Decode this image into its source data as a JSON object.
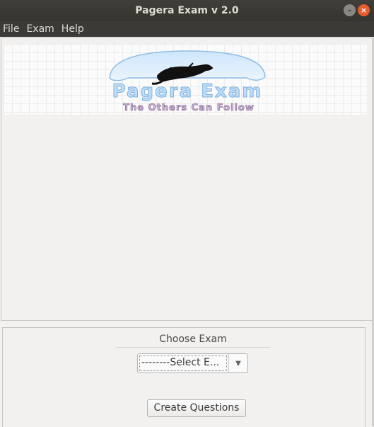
{
  "window": {
    "title": "Pagera Exam v 2.0"
  },
  "menubar": {
    "items": [
      "File",
      "Exam",
      "Help"
    ]
  },
  "banner": {
    "logo_text": "Pagera Exam",
    "tagline": "The Others Can Follow"
  },
  "choose": {
    "title": "Choose Exam",
    "selected": "--------Select E...",
    "create_label": "Create Questions"
  },
  "colors": {
    "titlebar": "#3f3e39",
    "close_button": "#e95a2c",
    "logo_blue": "#8fc3f0",
    "tagline_purple": "#7d5a8c"
  }
}
